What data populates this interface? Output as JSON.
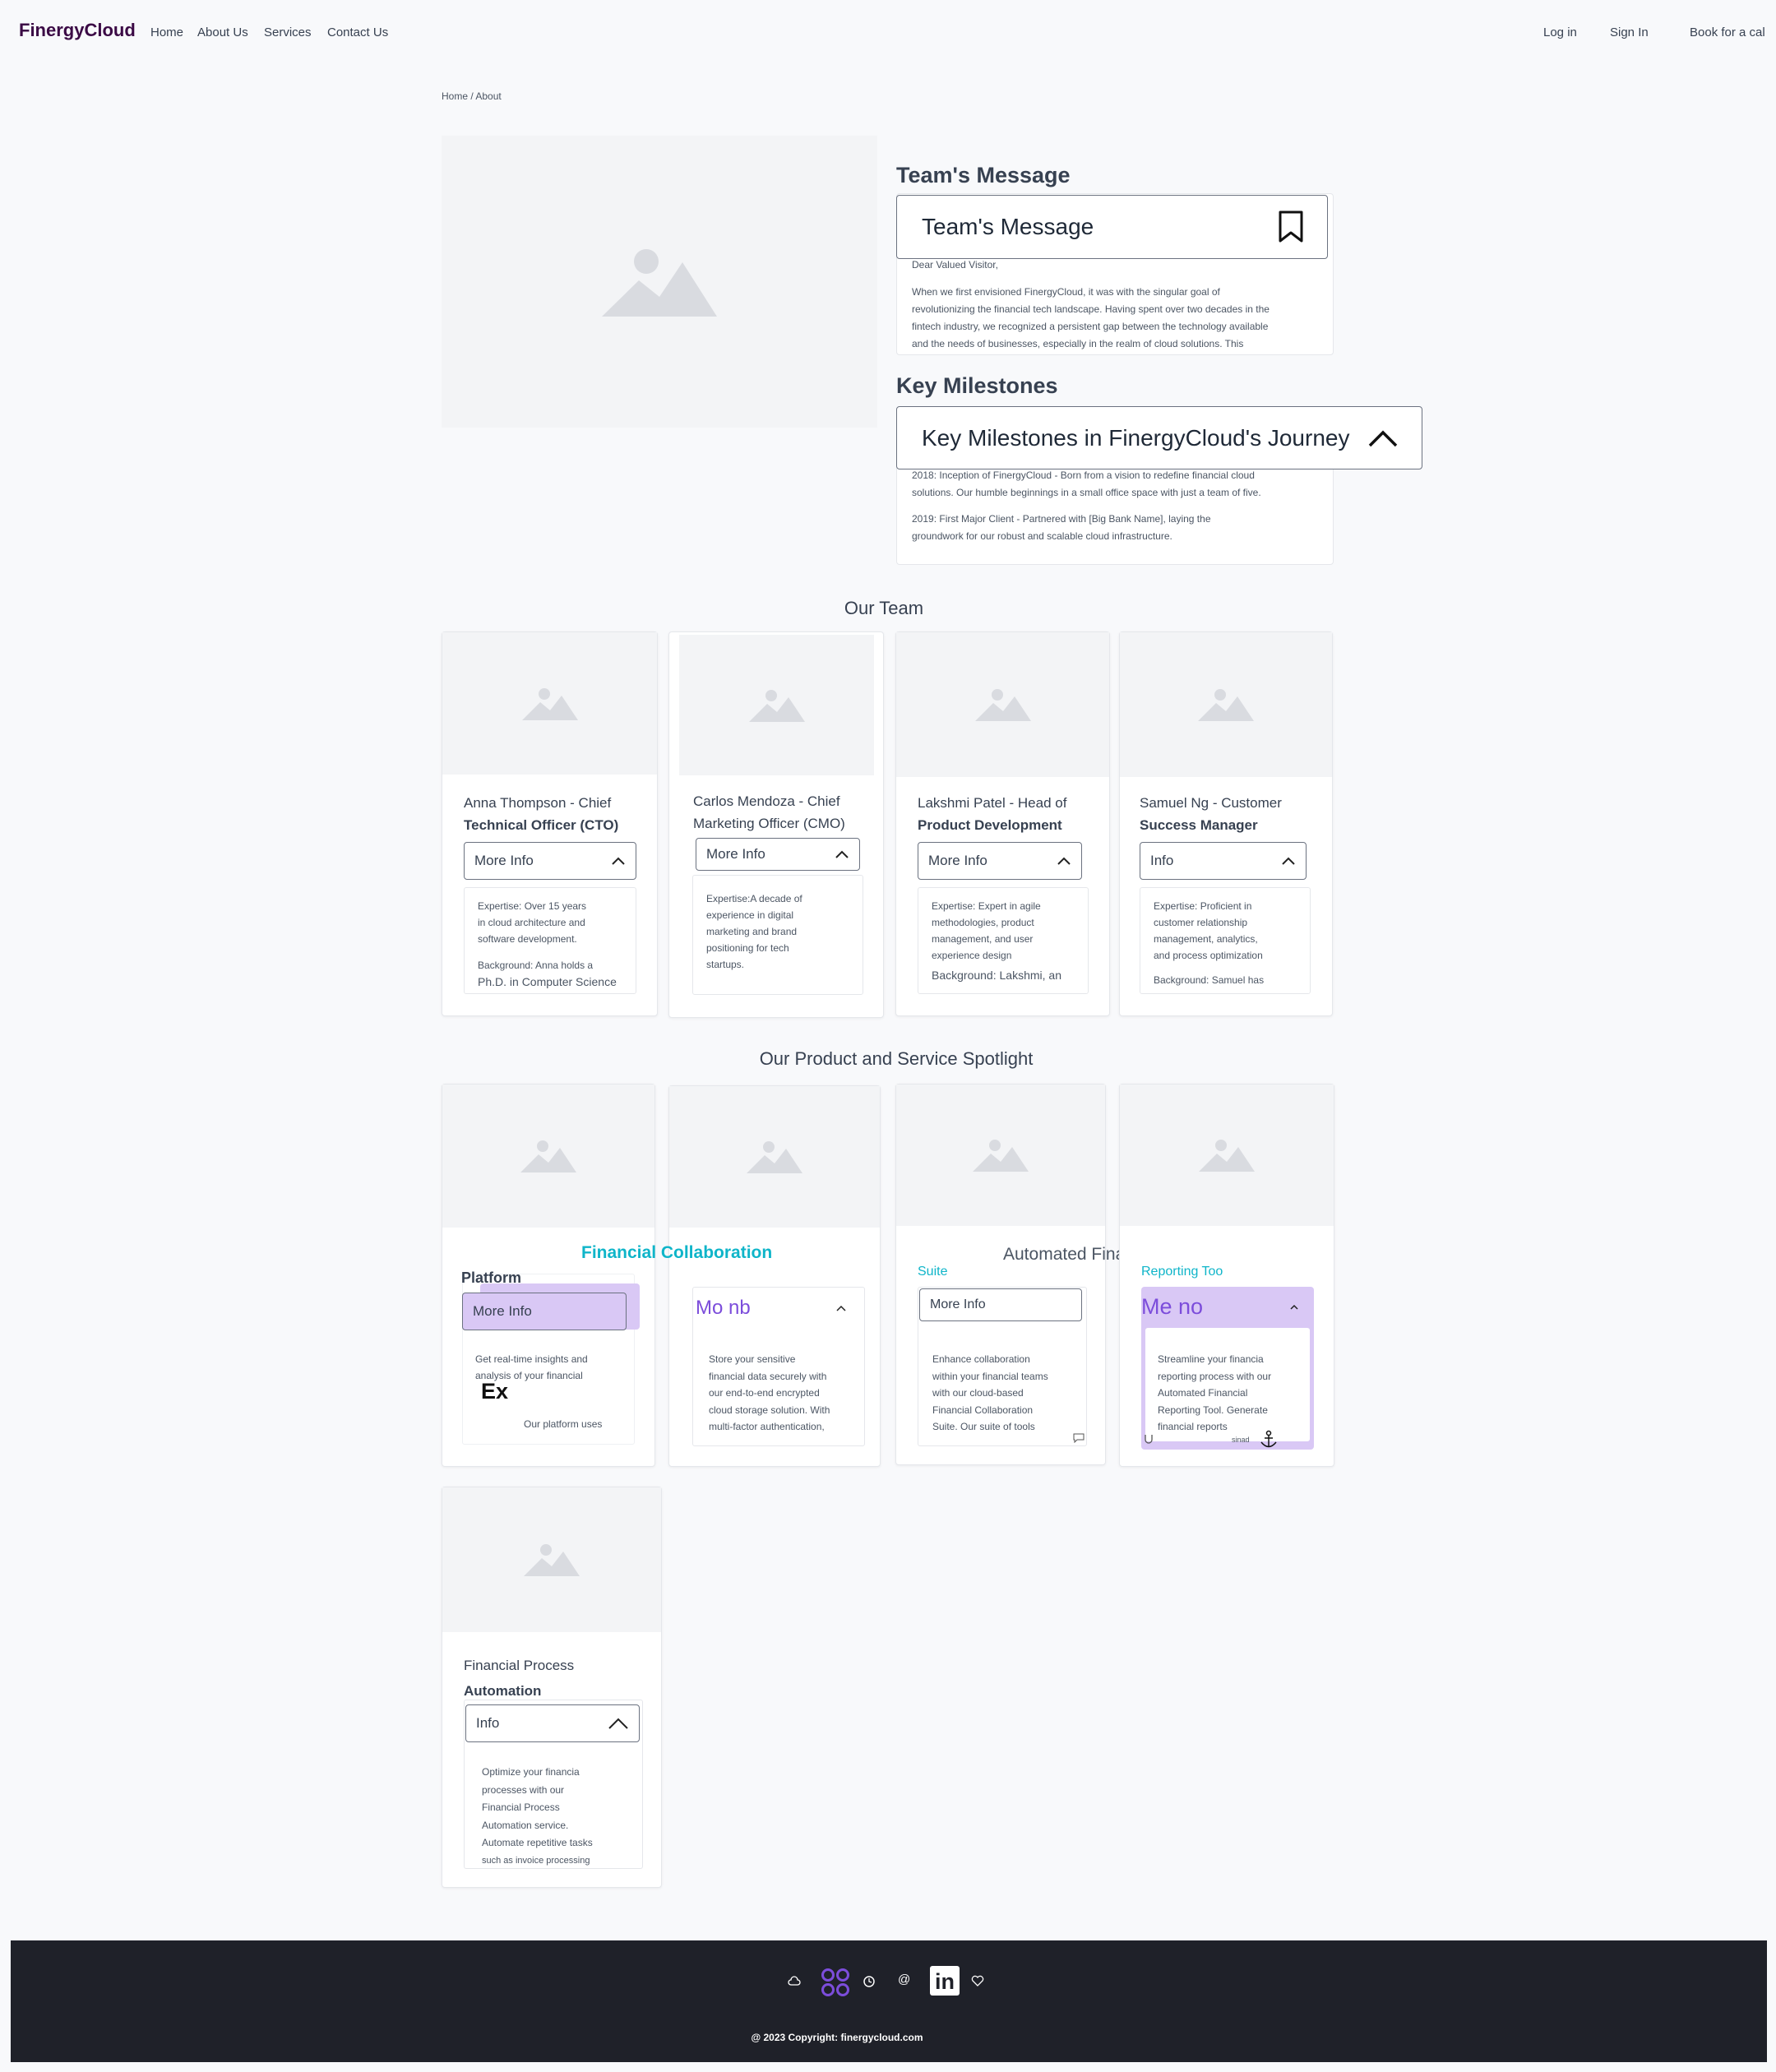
{
  "nav": {
    "logo": "FinergyCloud",
    "links": [
      "Home",
      "About Us",
      "Services",
      "Contact Us"
    ],
    "login": "Log in",
    "signin": "Sign In",
    "book": "Book for a cal"
  },
  "breadcrumb": "Home / About",
  "team_message": {
    "heading": "Team's Message",
    "button_label": "Team's Message",
    "greeting": "Dear Valued Visitor,",
    "lines": [
      "When we first envisioned FinergyCloud, it was with the singular goal of",
      "revolutionizing the financial tech landscape. Having spent over two decades in the",
      "fintech industry, we recognized a persistent gap between the technology available",
      "and the needs of businesses, especially in the realm of cloud solutions. This"
    ]
  },
  "milestones": {
    "heading": "Key Milestones",
    "button_label": "Key Milestones in FinergyCloud's Journey",
    "items": [
      [
        "2018: Inception of FinergyCloud - Born from a vision to redefine financial cloud",
        "solutions. Our humble beginnings in a small office space with just a team of five."
      ],
      [
        "2019: First Major Client - Partnered with [Big Bank Name], laying the",
        "groundwork for our robust and scalable cloud infrastructure."
      ]
    ]
  },
  "team": {
    "heading": "Our Team",
    "members": [
      {
        "line1": "Anna Thompson - Chief",
        "line2": "Technical Officer (CTO)",
        "button": "More Info",
        "body": [
          "Expertise: Over 15 years",
          "in cloud architecture and",
          "software development.",
          "",
          "Background: Anna holds a",
          "Ph.D. in Computer Science"
        ]
      },
      {
        "line1": "Carlos Mendoza - Chief",
        "line2": "Marketing Officer (CMO)",
        "button": "More Info",
        "body": [
          "Expertise:A decade of",
          "experience in digital",
          "marketing and brand",
          "positioning for tech",
          "startups."
        ]
      },
      {
        "line1": "Lakshmi Patel - Head of",
        "line2": "Product Development",
        "button": "More Info",
        "body": [
          "Expertise: Expert in agile",
          "methodologies, product",
          "management, and user",
          "experience design",
          "Background: Lakshmi, an"
        ]
      },
      {
        "line1": "Samuel Ng - Customer",
        "line2": "Success Manager",
        "button": "Info",
        "body": [
          "Expertise: Proficient in",
          "customer relationship",
          "management, analytics,",
          "and process optimization",
          "",
          "Background: Samuel has"
        ]
      }
    ]
  },
  "products": {
    "heading": "Our Product and Service Spotlight",
    "collab_title": "Financial Collaboration",
    "automated_title": "Automated Financial",
    "p1": {
      "title": "Platform",
      "button": "More Info",
      "body": [
        "Get real-time insights and",
        "analysis of your financial"
      ],
      "ex": "Ex",
      "footer": "Our platform uses"
    },
    "p2": {
      "button": "Mo nb",
      "body": [
        "Store your sensitive",
        "financial data securely with",
        "our end-to-end encrypted",
        "cloud storage solution. With",
        "multi-factor authentication,"
      ]
    },
    "p3": {
      "title": "Suite",
      "button": "More Info",
      "body": [
        "Enhance collaboration",
        "within your financial teams",
        "with our cloud-based",
        "Financial Collaboration",
        "Suite. Our suite of tools"
      ]
    },
    "p4": {
      "title": "Reporting Too",
      "button": "Me no",
      "body": [
        "Streamline your financia",
        "reporting process with our",
        "Automated Financial",
        "Reporting Tool. Generate",
        "financial reports"
      ],
      "small": "sinad"
    },
    "p5": {
      "line1": "Financial Process",
      "line2": "Automation",
      "button": "Info",
      "body": [
        "Optimize your financia",
        "processes with our",
        "Financial Process",
        "Automation service.",
        "Automate repetitive tasks",
        "such as invoice processing"
      ]
    }
  },
  "footer": {
    "copyright": "@ 2023 Copyright: finergycloud.com",
    "icons": [
      "cloud-icon",
      "apps-icon",
      "clock-icon",
      "at-icon",
      "linkedin-icon",
      "heart-icon"
    ],
    "linkedin": "in"
  },
  "colors": {
    "accent": "#7c4ddb",
    "teal": "#0fb5c9",
    "lavender": "#d9c8f5",
    "footer": "#1f2129"
  }
}
